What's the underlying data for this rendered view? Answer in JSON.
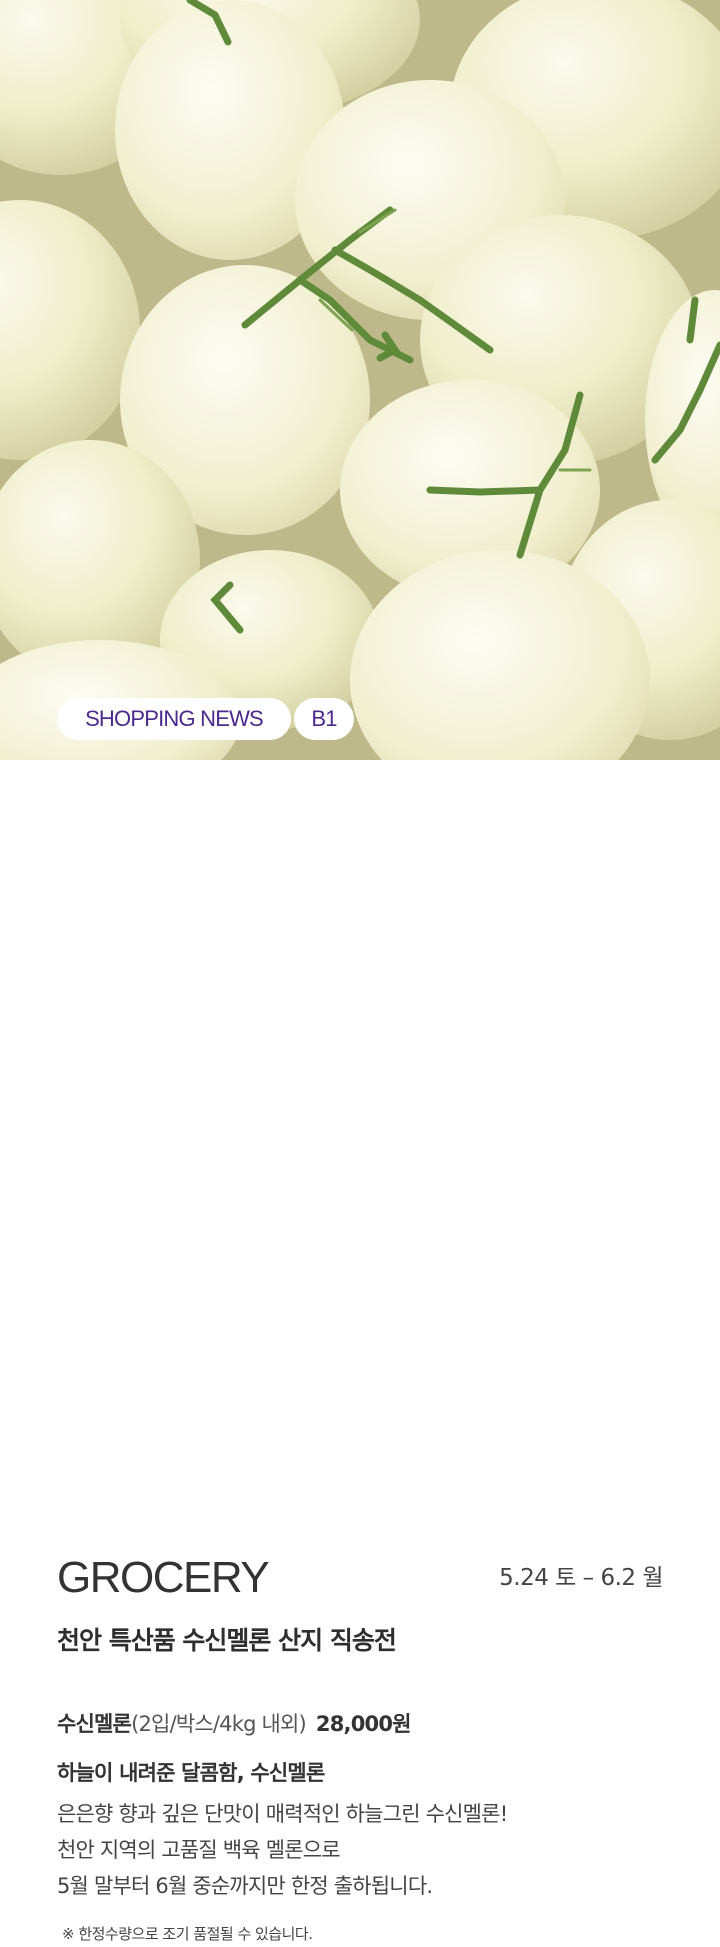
{
  "hero": {
    "image_description_icon": "melon-photo",
    "tags": {
      "section": "SHOPPING NEWS",
      "floor": "B1"
    }
  },
  "event": {
    "category": "GROCERY",
    "date_range": "5.24 토 – 6.2 월",
    "subtitle": "천안 특산품 수신멜론 산지 직송전",
    "product_name": "수신멜론",
    "product_spec": "(2입/박스/4kg 내외)",
    "price": "28,000원",
    "headline": "하늘이 내려준 달콤함, 수신멜론",
    "description": [
      "은은향 향과 깊은 단맛이 매력적인 하늘그린 수신멜론!",
      "천안 지역의 고품질 백육 멜론으로",
      "5월 말부터 6월 중순까지만 한정 출하됩니다."
    ],
    "notice": "※ 한정수량으로 조기 품절될 수 있습니다."
  },
  "colors": {
    "accent_purple": "#4b2a8c",
    "text_dark": "#333333",
    "melon_cream": "#f3f1d2",
    "stem_green": "#5e8a3a"
  }
}
